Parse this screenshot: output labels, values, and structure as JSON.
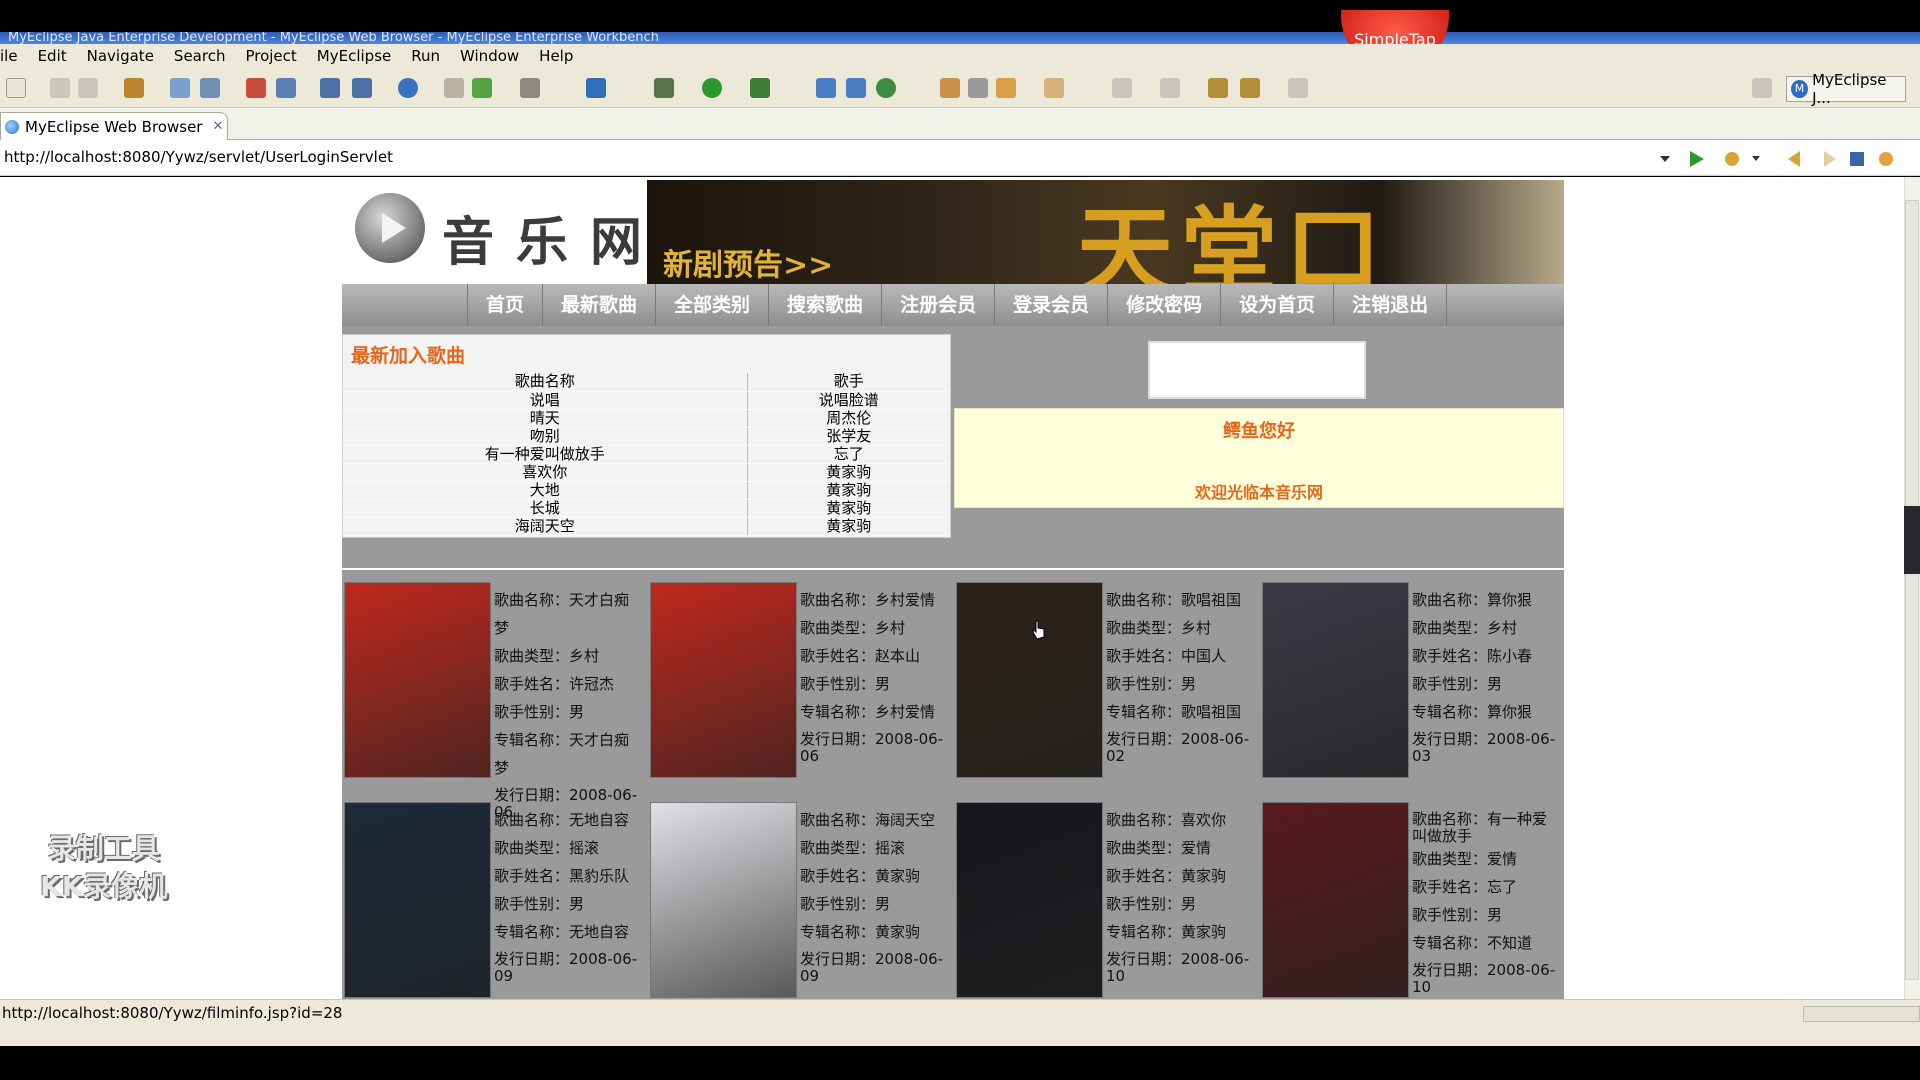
{
  "window": {
    "title": "MyEclipse Java Enterprise Development - MyEclipse Web Browser - MyEclipse Enterprise Workbench",
    "badge": "SimpleTap"
  },
  "menu": [
    "ile",
    "Edit",
    "Navigate",
    "Search",
    "Project",
    "MyEclipse",
    "Run",
    "Window",
    "Help"
  ],
  "perspective": {
    "label": "MyEclipse J..."
  },
  "editor_tab": {
    "label": "MyEclipse Web Browser",
    "close": "✕"
  },
  "browser": {
    "url": "http://localhost:8080/Yywz/servlet/UserLoginServlet",
    "status_url": "http://localhost:8080/Yywz/filminfo.jsp?id=28"
  },
  "site": {
    "logo_text": "音乐网",
    "banner_promo": "新剧预告>>",
    "banner_title": "天堂口",
    "nav": [
      "首页",
      "最新歌曲",
      "全部类别",
      "搜索歌曲",
      "注册会员",
      "登录会员",
      "修改密码",
      "设为首页",
      "注销退出"
    ],
    "new_songs": {
      "heading": "最新加入歌曲",
      "columns": [
        "歌曲名称",
        "歌手"
      ],
      "rows": [
        [
          "说唱",
          "说唱脸谱"
        ],
        [
          "晴天",
          "周杰伦"
        ],
        [
          "吻别",
          "张学友"
        ],
        [
          "有一种爱叫做放手",
          "忘了"
        ],
        [
          "喜欢你",
          "黄家驹"
        ],
        [
          "大地",
          "黄家驹"
        ],
        [
          "长城",
          "黄家驹"
        ],
        [
          "海阔天空",
          "黄家驹"
        ]
      ]
    },
    "welcome": {
      "greeting": "鳄鱼您好",
      "message": "欢迎光临本音乐网"
    },
    "labels": {
      "name": "歌曲名称：",
      "type": "歌曲类型：",
      "singer": "歌手姓名：",
      "gender": "歌手性别：",
      "album": "专辑名称：",
      "date": "发行日期："
    },
    "cards": [
      {
        "name": "天才白痴梦",
        "type": "乡村",
        "singer": "许冠杰",
        "gender": "男",
        "album": "天才白痴梦",
        "date": "2008-06-06",
        "cover": "#c0281e"
      },
      {
        "name": "乡村爱情",
        "type": "乡村",
        "singer": "赵本山",
        "gender": "男",
        "album": "乡村爱情",
        "date": "2008-06-06",
        "cover": "#c0281e"
      },
      {
        "name": "歌唱祖国",
        "type": "乡村",
        "singer": "中国人",
        "gender": "男",
        "album": "歌唱祖国",
        "date": "2008-06-02",
        "cover": "#2a2218"
      },
      {
        "name": "算你狠",
        "type": "乡村",
        "singer": "陈小春",
        "gender": "男",
        "album": "算你狠",
        "date": "2008-06-03",
        "cover": "#3a3a44"
      },
      {
        "name": "无地自容",
        "type": "摇滚",
        "singer": "黑豹乐队",
        "gender": "男",
        "album": "无地自容",
        "date": "2008-06-09",
        "cover": "#1e2a3a"
      },
      {
        "name": "海阔天空",
        "type": "摇滚",
        "singer": "黄家驹",
        "gender": "男",
        "album": "黄家驹",
        "date": "2008-06-09",
        "cover": "#dfe1e4"
      },
      {
        "name": "喜欢你",
        "type": "爱情",
        "singer": "黄家驹",
        "gender": "男",
        "album": "黄家驹",
        "date": "2008-06-10",
        "cover": "#14161a"
      },
      {
        "name": "有一种爱叫做放手",
        "type": "爱情",
        "singer": "忘了",
        "gender": "男",
        "album": "不知道",
        "date": "2008-06-10",
        "cover": "#5a1a1e"
      }
    ]
  },
  "watermark": {
    "line1": "录制工具",
    "line2": "KK录像机"
  }
}
